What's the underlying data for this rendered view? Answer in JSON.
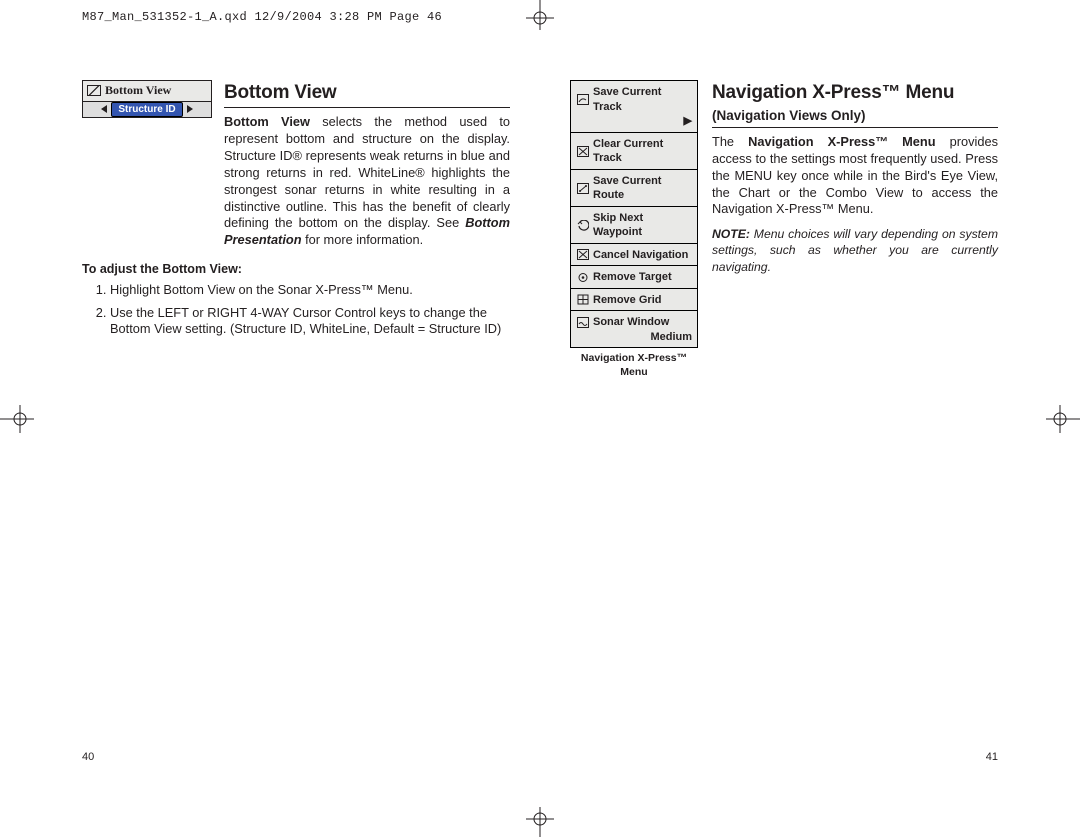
{
  "slugline": "M87_Man_531352-1_A.qxd  12/9/2004  3:28 PM  Page 46",
  "left": {
    "heading": "Bottom View",
    "ui_title": "Bottom View",
    "ui_value": "Structure ID",
    "para1_lead": "Bottom View",
    "para1": " selects the method used to represent bottom and structure on the display. Structure ID® represents weak returns in blue and strong returns in red. WhiteLine® highlights the strongest sonar returns in white resulting in a distinctive outline. This has the benefit of clearly defining the bottom on the display. See ",
    "para1_ital": "Bottom Presentation",
    "para1_tail": " for more information.",
    "subhead": "To adjust the Bottom View:",
    "steps": [
      "Highlight Bottom View on the Sonar X-Press™ Menu.",
      "Use the LEFT or RIGHT 4-WAY Cursor Control keys to change the Bottom View setting. (Structure ID, WhiteLine, Default = Structure ID)"
    ],
    "folio": "40"
  },
  "right": {
    "heading": "Navigation X-Press™ Menu",
    "subheading": "(Navigation Views Only)",
    "menu_items": [
      "Save Current Track",
      "Clear Current Track",
      "Save Current Route",
      "Skip Next Waypoint",
      "Cancel Navigation",
      "Remove Target",
      "Remove Grid",
      "Sonar Window"
    ],
    "menu_last_value": "Medium",
    "menu_caption": "Navigation X-Press™ Menu",
    "para1a": "The ",
    "para1b": "Navigation X-Press™ Menu",
    "para1c": " provides access to the settings most frequently used.  Press the MENU key once while in the Bird's Eye View, the Chart or the Combo View to access the Navigation X-Press™ Menu.",
    "note_label": "NOTE:",
    "note": "  Menu choices will vary depending on system settings, such as whether you are currently navigating.",
    "folio": "41"
  }
}
